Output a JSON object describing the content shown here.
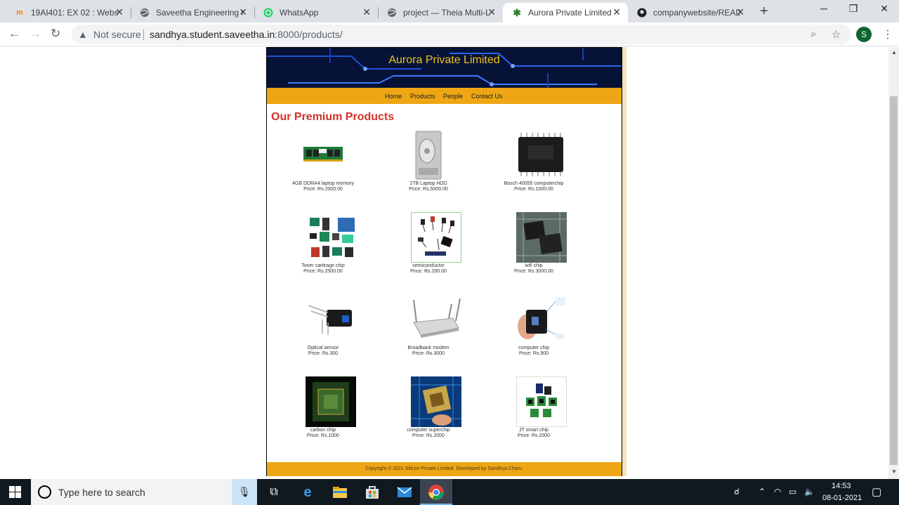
{
  "browser": {
    "tabs": [
      {
        "title": "19AI401: EX 02 : Websit",
        "icon": "moodle-icon",
        "active": false
      },
      {
        "title": "Saveetha Engineering C",
        "icon": "globe-icon",
        "active": false
      },
      {
        "title": "WhatsApp",
        "icon": "whatsapp-icon",
        "active": false
      },
      {
        "title": "project — Theia Multi-L",
        "icon": "globe-icon",
        "active": false
      },
      {
        "title": "Aurora Private Limited",
        "icon": "gear-icon",
        "active": true
      },
      {
        "title": "companywebsite/READ",
        "icon": "github-icon",
        "active": false
      }
    ],
    "new_tab_symbol": "+",
    "address": {
      "security_label": "Not secure",
      "host": "sandhya.student.saveetha.in",
      "path": ":8000/products/"
    },
    "profile_initial": "S"
  },
  "site": {
    "banner_title": "Aurora Private Limited",
    "nav": [
      "Home",
      "Products",
      "People",
      "Contact Us"
    ],
    "heading": "Our Premium Products",
    "products": [
      {
        "name": "4GB DDRA4 laptop memory",
        "price": "Price: Rs.2000.00",
        "icon": "ram-stick-icon"
      },
      {
        "name": "1TB Laptop HDD",
        "price": "Price: Rs.5000.00",
        "icon": "hard-disk-icon"
      },
      {
        "name": "Bosch 40055 computerchip",
        "price": "Price: Rs.1000.00",
        "icon": "ic-chip-icon"
      },
      {
        "name": "Toner cartirage chip",
        "price": "Price: Rs.2500.00",
        "icon": "toner-chip-icon"
      },
      {
        "name": "semiconductor",
        "price": "Price: Rs.200.00",
        "icon": "semiconductor-icon"
      },
      {
        "name": "wifi chip",
        "price": "Price: Rs.3000.00",
        "icon": "wifi-chip-icon"
      },
      {
        "name": "Optical sensor",
        "price": "Price: Rs.300",
        "icon": "optical-sensor-icon"
      },
      {
        "name": "Broadbank modem",
        "price": "Price: Rs.3000",
        "icon": "modem-icon"
      },
      {
        "name": "computer chip",
        "price": "Price: Rs.900",
        "icon": "computer-chip-icon"
      },
      {
        "name": "carbon chip",
        "price": "Price: Rs.1000",
        "icon": "carbon-chip-icon"
      },
      {
        "name": "computer superchip",
        "price": "Price: Rs.2000",
        "icon": "superchip-icon"
      },
      {
        "name": "JT smart chip",
        "price": "Price: Rs.2000",
        "icon": "smart-chip-icon"
      }
    ],
    "footer": "Copyright © 2021 Silicon Private Limited. Developed by Sandhya Charu."
  },
  "taskbar": {
    "search_placeholder": "Type here to search",
    "time": "14:53",
    "date": "08-01-2021"
  },
  "colors": {
    "banner_text": "#f0c419",
    "nav_bg": "#eea615",
    "heading": "#d3322b",
    "profile": "#0d652d"
  }
}
